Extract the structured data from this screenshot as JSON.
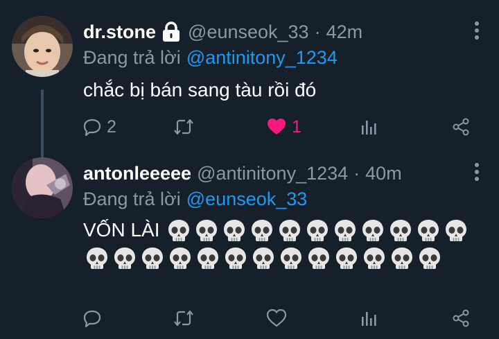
{
  "tweets": [
    {
      "display_name": "dr.stone",
      "protected": true,
      "handle": "@eunseok_33",
      "separator": "·",
      "time": "42m",
      "reply_prefix": "Đang trả lời",
      "reply_to": "@antinitony_1234",
      "text": "chắc bị bán sang tàu rồi đó",
      "reply_count": "2",
      "retweet_count": "",
      "like_count": "1",
      "liked": true,
      "like_color": "#f91880"
    },
    {
      "display_name": "antonleeeee",
      "handle": "@antinitony_1234",
      "separator": "·",
      "time": "40m",
      "reply_prefix": "Đang trả lời",
      "reply_to": "@eunseok_33",
      "text": "VỐN LÀI",
      "emoji": "skull",
      "emoji_count": 24,
      "reply_count": "",
      "retweet_count": "",
      "like_count": "",
      "liked": false
    }
  ],
  "colors": {
    "background": "#15202b",
    "text": "#ffffff",
    "muted": "#8b98a5",
    "mention": "#1d9bf0",
    "like": "#f91880",
    "thread_line": "#3d4f5f"
  },
  "icons": [
    "lock-icon",
    "more-icon",
    "reply-icon",
    "retweet-icon",
    "heart-icon",
    "stats-icon",
    "share-icon",
    "skull-icon"
  ]
}
